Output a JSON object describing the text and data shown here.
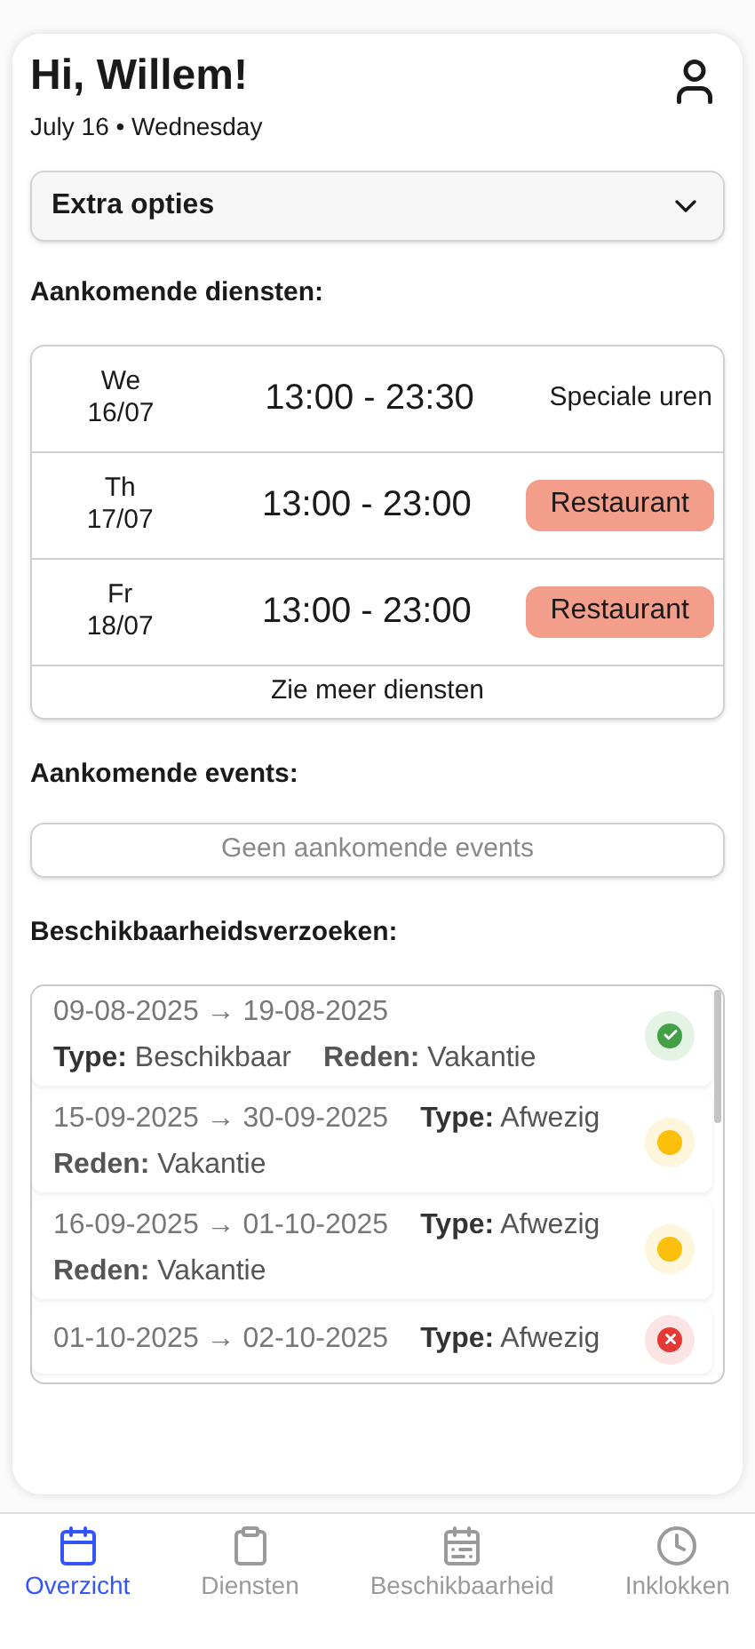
{
  "header": {
    "greeting": "Hi, Willem!",
    "date": "July 16 • Wednesday"
  },
  "extra_options": {
    "label": "Extra opties",
    "expanded": false
  },
  "shifts_section": {
    "title": "Aankomende diensten:",
    "more": "Zie meer diensten",
    "rows": [
      {
        "day": "We",
        "date": "16/07",
        "time": "13:00 - 23:30",
        "kind": "text",
        "tag": "Speciale uren"
      },
      {
        "day": "Th",
        "date": "17/07",
        "time": "13:00 - 23:00",
        "kind": "badge",
        "tag": "Restaurant"
      },
      {
        "day": "Fr",
        "date": "18/07",
        "time": "13:00 - 23:00",
        "kind": "badge",
        "tag": "Restaurant"
      }
    ]
  },
  "events_section": {
    "title": "Aankomende events:",
    "empty": "Geen aankomende events"
  },
  "requests_section": {
    "title": "Beschikbaarheidsverzoeken:",
    "items": [
      {
        "dates": "09-08-2025 → 19-08-2025",
        "type": "**Type:** Beschikbaar",
        "reason": "**Reden:** Vakantie",
        "kind": "approved"
      },
      {
        "dates": "15-09-2025 → 30-09-2025",
        "type": "**Type:** Afwezig",
        "reason": "**Reden:** Vakantie",
        "kind": "pending"
      },
      {
        "dates": "16-09-2025 → 01-10-2025",
        "type": "**Type:** Afwezig",
        "reason": "**Reden:** Vakantie",
        "kind": "pending"
      },
      {
        "dates": "01-10-2025 → 02-10-2025",
        "type": "**Type:** Afwezig",
        "kind": "rejected"
      }
    ]
  },
  "nav": [
    {
      "label": "Overzicht",
      "kind": "calendar",
      "selected": true
    },
    {
      "label": "Diensten",
      "kind": "clipboard",
      "selected": false
    },
    {
      "label": "Beschikbaarheid",
      "kind": "calendar-fill",
      "selected": false
    },
    {
      "label": "Inklokken",
      "kind": "clock",
      "selected": false
    }
  ]
}
